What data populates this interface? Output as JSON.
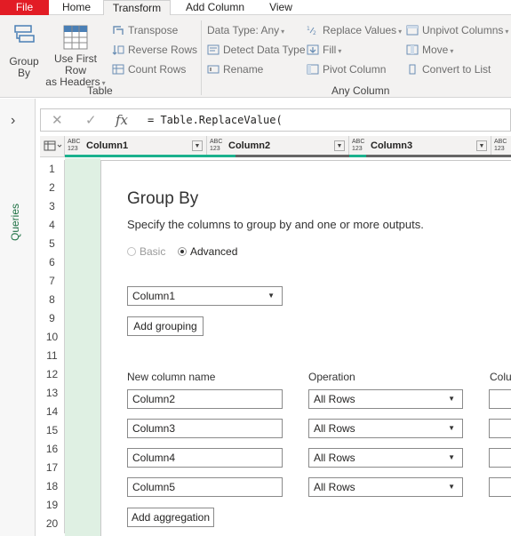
{
  "tabs": [
    "File",
    "Home",
    "Transform",
    "Add Column",
    "View"
  ],
  "ribbon": {
    "group_by": "Group By",
    "use_first_row": [
      "Use First Row",
      "as Headers"
    ],
    "transpose": "Transpose",
    "reverse_rows": "Reverse Rows",
    "count_rows": "Count Rows",
    "table_group": "Table",
    "data_type": "Data Type: Any",
    "detect_data_type": "Detect Data Type",
    "rename": "Rename",
    "replace_values": "Replace Values",
    "fill": "Fill",
    "pivot_column": "Pivot Column",
    "unpivot_columns": "Unpivot Columns",
    "move": "Move",
    "convert_to_list": "Convert to List",
    "any_column_group": "Any Column"
  },
  "queries_label": "Queries",
  "formula": "= Table.ReplaceValue(",
  "columns": [
    {
      "type_top": "ABC",
      "type_bot": "123",
      "name": "Column1"
    },
    {
      "type_top": "ABC",
      "type_bot": "123",
      "name": "Column2"
    },
    {
      "type_top": "ABC",
      "type_bot": "123",
      "name": "Column3"
    },
    {
      "type_top": "ABC",
      "type_bot": "123",
      "name": ""
    }
  ],
  "rows": [
    "1",
    "2",
    "3",
    "4",
    "5",
    "6",
    "7",
    "8",
    "9",
    "10",
    "11",
    "12",
    "13",
    "14",
    "15",
    "16",
    "17",
    "18",
    "19",
    "20"
  ],
  "dialog": {
    "title": "Group By",
    "description": "Specify the columns to group by and one or more outputs.",
    "basic": "Basic",
    "advanced": "Advanced",
    "grouping_value": "Column1",
    "add_grouping": "Add grouping",
    "new_col_header": "New column name",
    "operation_header": "Operation",
    "column_header": "Colu",
    "aggregations": [
      {
        "name": "Column2",
        "op": "All Rows"
      },
      {
        "name": "Column3",
        "op": "All Rows"
      },
      {
        "name": "Column4",
        "op": "All Rows"
      },
      {
        "name": "Column5",
        "op": "All Rows"
      }
    ],
    "add_aggregation": "Add aggregation"
  },
  "colors": {
    "accent": "#217346",
    "file_tab": "#e21c25",
    "col1_bg": "#dff0e3"
  }
}
